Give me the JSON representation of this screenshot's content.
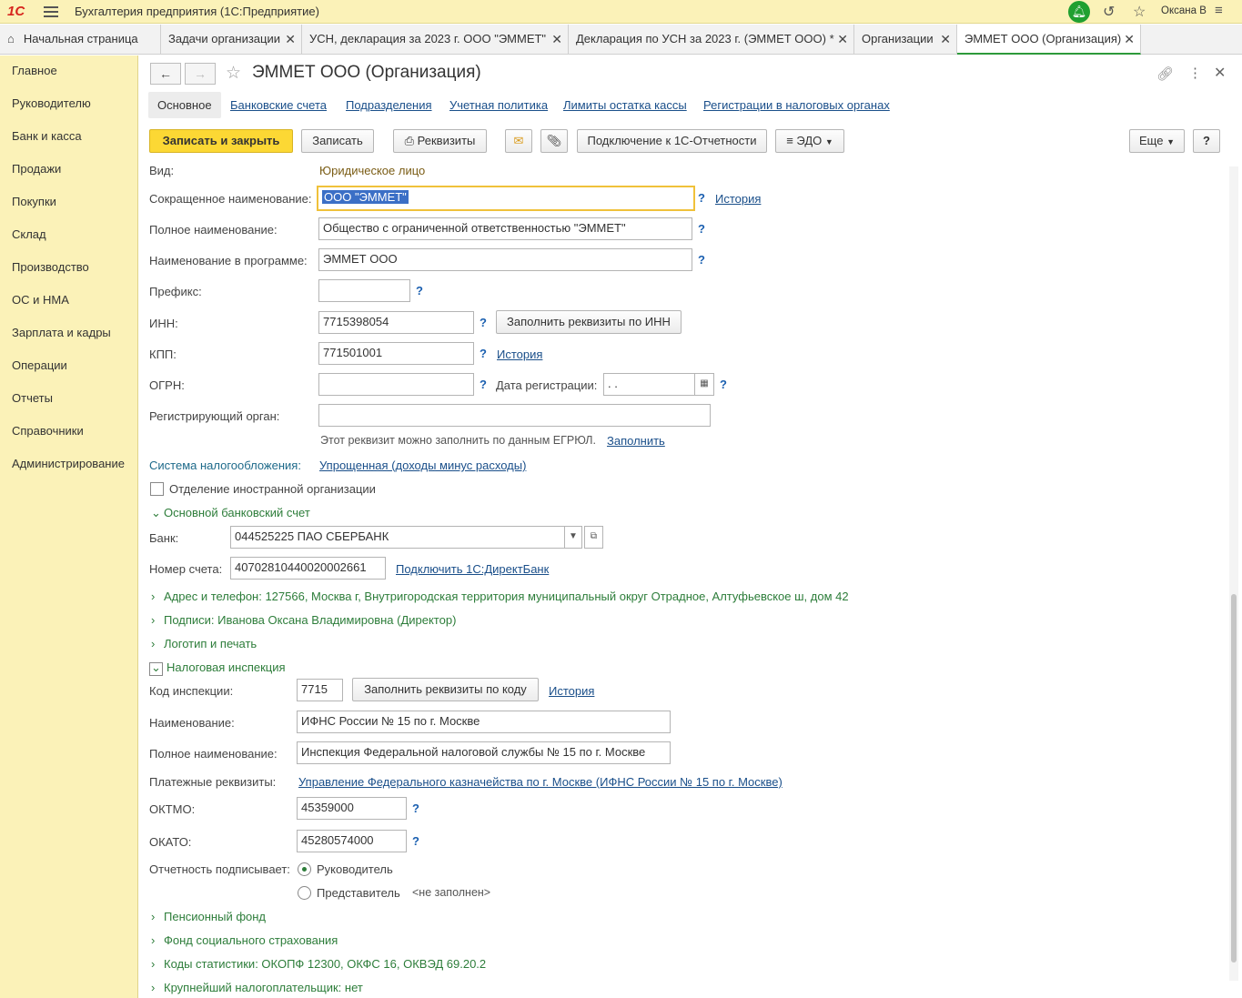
{
  "titlebar": {
    "logo": "1С",
    "app_title": "Бухгалтерия предприятия  (1С:Предприятие)",
    "user": "Оксана В"
  },
  "tabs": [
    {
      "label": "Начальная страница"
    },
    {
      "label": "Задачи организации"
    },
    {
      "label": "УСН, декларация за 2023 г. ООО \"ЭММЕТ\""
    },
    {
      "label": "Декларация по УСН за 2023 г. (ЭММЕТ ООО) *"
    },
    {
      "label": "Организации"
    },
    {
      "label": "ЭММЕТ ООО (Организация)"
    }
  ],
  "sidebar": {
    "items": [
      {
        "label": "Главное"
      },
      {
        "label": "Руководителю"
      },
      {
        "label": "Банк и касса"
      },
      {
        "label": "Продажи"
      },
      {
        "label": "Покупки"
      },
      {
        "label": "Склад"
      },
      {
        "label": "Производство"
      },
      {
        "label": "ОС и НМА"
      },
      {
        "label": "Зарплата и кадры"
      },
      {
        "label": "Операции"
      },
      {
        "label": "Отчеты"
      },
      {
        "label": "Справочники"
      },
      {
        "label": "Администрирование"
      }
    ]
  },
  "form": {
    "title": "ЭММЕТ ООО (Организация)",
    "section_tabs": [
      "Основное",
      "Банковские счета",
      "Подразделения",
      "Учетная политика",
      "Лимиты остатка кассы",
      "Регистрации в налоговых органах"
    ],
    "toolbar": {
      "save_close": "Записать и закрыть",
      "save": "Записать",
      "requisites": "Реквизиты",
      "connect": "Подключение к 1С-Отчетности",
      "edo": "ЭДО",
      "more": "Еще",
      "help": "?"
    },
    "fields": {
      "kind_label": "Вид:",
      "kind_value": "Юридическое лицо",
      "short_name_label": "Сокращенное наименование:",
      "short_name_value": "ООО \"ЭММЕТ\"",
      "full_name_label": "Полное наименование:",
      "full_name_value": "Общество с ограниченной ответственностью \"ЭММЕТ\"",
      "prog_name_label": "Наименование в программе:",
      "prog_name_value": "ЭММЕТ ООО",
      "prefix_label": "Префикс:",
      "prefix_value": "",
      "inn_label": "ИНН:",
      "inn_value": "7715398054",
      "fill_by_inn": "Заполнить реквизиты по ИНН",
      "kpp_label": "КПП:",
      "kpp_value": "771501001",
      "ogrn_label": "ОГРН:",
      "ogrn_value": "",
      "reg_date_label": "Дата регистрации:",
      "reg_date_value": " .  .",
      "reg_org_label": "Регистрирующий орган:",
      "reg_org_value": "",
      "egrul_hint": "Этот реквизит можно заполнить по данным ЕГРЮЛ.",
      "fill": "Заполнить",
      "history": "История",
      "help_mark": "?"
    },
    "tax_system_label": "Система налогообложения:",
    "tax_system_value": "Упрощенная (доходы минус расходы)",
    "foreign_branch": "Отделение иностранной организации",
    "bank_section": {
      "title": "Основной банковский счет",
      "bank_label": "Банк:",
      "bank_value": "044525225 ПАО СБЕРБАНК",
      "account_label": "Номер счета:",
      "account_value": "40702810440020002661",
      "directbank": "Подключить 1С:ДиректБанк"
    },
    "collapsed": {
      "address": "Адрес и телефон: 127566, Москва г, Внутригородская территория муниципальный округ Отрадное, Алтуфьевское ш, дом 42",
      "signatures": "Подписи: Иванова Оксана Владимировна (Директор)",
      "logo": "Логотип и печать"
    },
    "tax_office": {
      "title": "Налоговая инспекция",
      "code_label": "Код инспекции:",
      "code_value": "7715",
      "fill_by_code": "Заполнить реквизиты по коду",
      "history": "История",
      "name_label": "Наименование:",
      "name_value": "ИФНС России № 15 по г. Москве",
      "full_name_label": "Полное наименование:",
      "full_name_value": "Инспекция Федеральной налоговой службы № 15 по г. Москве",
      "payment_label": "Платежные реквизиты:",
      "payment_value": "Управление Федерального казначейства по г. Москве (ИФНС России № 15 по г. Москве)",
      "oktmo_label": "ОКТМО:",
      "oktmo_value": "45359000",
      "okato_label": "ОКАТО:",
      "okato_value": "45280574000",
      "signer_label": "Отчетность подписывает:",
      "signer_head": "Руководитель",
      "signer_rep": "Представитель",
      "not_filled": "<не заполнен>"
    },
    "bottom": {
      "pension": "Пенсионный фонд",
      "fss": "Фонд социального страхования",
      "stat_codes": "Коды статистики: ОКОПФ 12300, ОКФС 16, ОКВЭД 69.20.2",
      "largest": "Крупнейший налогоплательщик: нет"
    }
  }
}
